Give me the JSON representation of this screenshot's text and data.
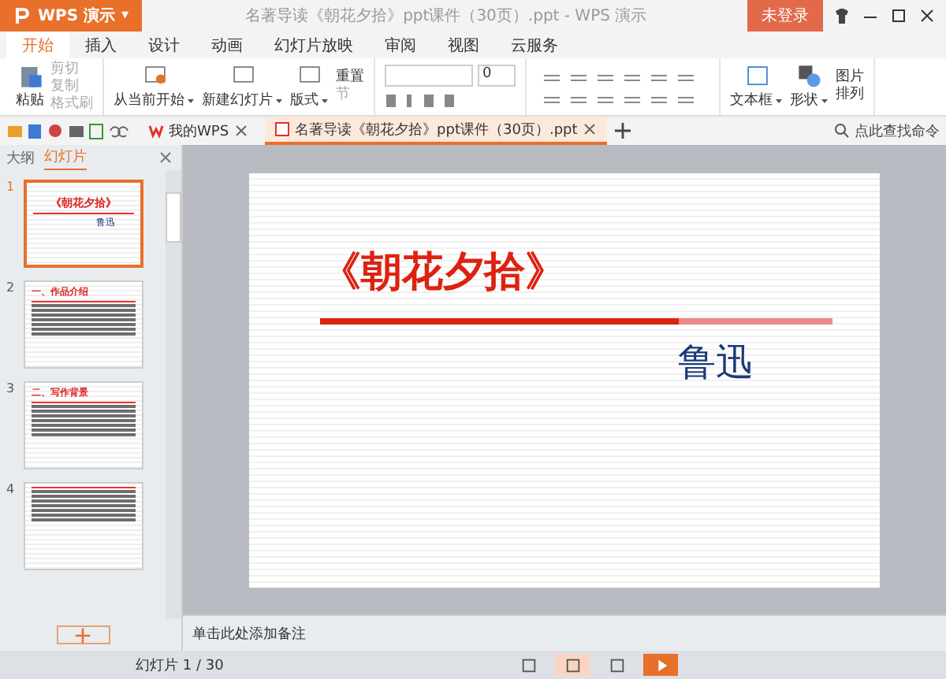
{
  "app_button": {
    "label": "WPS 演示",
    "caret": "▾"
  },
  "window": {
    "title": "名著导读《朝花夕拾》ppt课件（30页）.ppt - WPS 演示",
    "login": "未登录"
  },
  "menu_tabs": [
    {
      "label": "开始",
      "selected": true
    },
    {
      "label": "插入",
      "selected": false
    },
    {
      "label": "设计",
      "selected": false
    },
    {
      "label": "动画",
      "selected": false
    },
    {
      "label": "幻灯片放映",
      "selected": false
    },
    {
      "label": "审阅",
      "selected": false
    },
    {
      "label": "视图",
      "selected": false
    },
    {
      "label": "云服务",
      "selected": false
    }
  ],
  "ribbon": {
    "paste": "粘贴",
    "small_tools": [
      {
        "label": "剪切",
        "disabled": true
      },
      {
        "label": "复制",
        "disabled": true
      },
      {
        "label": "格式刷",
        "disabled": true
      }
    ],
    "big_tools": [
      {
        "label": "从当前开始"
      },
      {
        "label": "新建幻灯片"
      },
      {
        "label": "版式"
      }
    ],
    "reset": "重置",
    "section": {
      "label": "节",
      "disabled": true
    },
    "font_size": "0",
    "insert_tools": [
      {
        "label": "文本框"
      },
      {
        "label": "形状"
      }
    ],
    "right_tools": [
      {
        "label": "图片"
      },
      {
        "label": "排列"
      }
    ]
  },
  "doc_tabs": [
    {
      "label": "我的WPS",
      "selected": false
    },
    {
      "label": "名著导读《朝花夕拾》ppt课件（30页）.ppt",
      "selected": true
    }
  ],
  "command_search": {
    "placeholder": "点此查找命令"
  },
  "pane_tabs": [
    {
      "label": "大纲",
      "selected": false
    },
    {
      "label": "幻灯片",
      "selected": true
    }
  ],
  "thumbnails": [
    {
      "number": "1",
      "selected": true,
      "title": "《朝花夕拾》",
      "author": "鲁迅"
    },
    {
      "number": "2",
      "selected": false,
      "title": "一、作品介绍"
    },
    {
      "number": "3",
      "selected": false,
      "title": "二、写作背景"
    },
    {
      "number": "4",
      "selected": false
    }
  ],
  "slide": {
    "title": "《朝花夕拾》",
    "author": "鲁迅"
  },
  "notes": {
    "placeholder": "单击此处添加备注"
  },
  "status_bar": {
    "slide_counter": "幻灯片 1 / 30"
  },
  "view_buttons": [
    {
      "selected": false
    },
    {
      "selected": true
    },
    {
      "selected": false
    },
    {
      "selected": false
    }
  ]
}
